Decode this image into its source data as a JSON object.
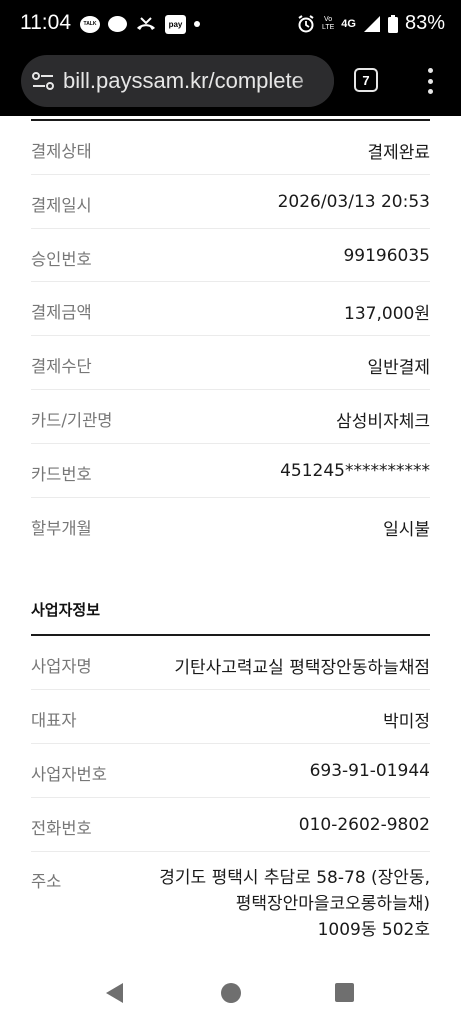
{
  "status_bar": {
    "time": "11:04",
    "talk_icon_text": "TALK",
    "pay_icon_text": "pay",
    "volte_line1": "Vo",
    "volte_line2": "LTE",
    "network": "4G",
    "battery": "83%"
  },
  "browser": {
    "url": "bill.payssam.kr/complete",
    "tab_count": "7"
  },
  "payment_rows": [
    {
      "label": "결제상태",
      "value": "결제완료"
    },
    {
      "label": "결제일시",
      "value": "2026/03/13 20:53"
    },
    {
      "label": "승인번호",
      "value": "99196035"
    },
    {
      "label": "결제금액",
      "value": "137,000원"
    },
    {
      "label": "결제수단",
      "value": "일반결제"
    },
    {
      "label": "카드/기관명",
      "value": "삼성비자체크"
    },
    {
      "label": "카드번호",
      "value": "451245**********"
    },
    {
      "label": "할부개월",
      "value": "일시불"
    }
  ],
  "business": {
    "title": "사업자정보",
    "rows": [
      {
        "label": "사업자명",
        "value": "기탄사고력교실 평택장안동하늘채점"
      },
      {
        "label": "대표자",
        "value": "박미정"
      },
      {
        "label": "사업자번호",
        "value": "693-91-01944"
      },
      {
        "label": "전화번호",
        "value": "010-2602-9802"
      }
    ],
    "address_label": "주소",
    "address_lines": [
      "경기도 평택시 추담로 58-78 (장안동,",
      "평택장안마을코오롱하늘채)",
      "1009동 502호"
    ]
  }
}
